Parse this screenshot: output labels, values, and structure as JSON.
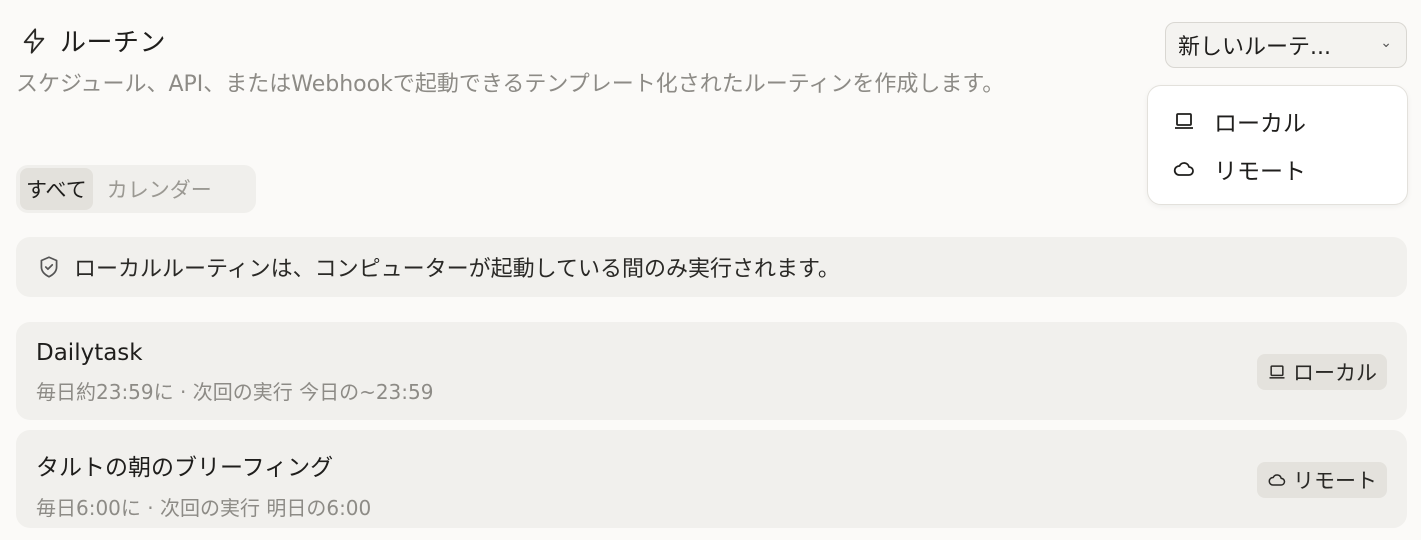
{
  "header": {
    "title": "ルーチン",
    "icon": "lightning-icon"
  },
  "description": "スケジュール、API、またはWebhookで起動できるテンプレート化されたルーティンを作成します。",
  "tabs": [
    {
      "label": "すべて",
      "active": true
    },
    {
      "label": "カレンダー",
      "active": false
    }
  ],
  "notice": {
    "icon": "shield-check-icon",
    "text": "ローカルルーティンは、コンピューターが起動している間のみ実行されます。"
  },
  "routines": [
    {
      "title": "Dailytask",
      "schedule": "毎日約23:59に · 次回の実行 今日の~23:59",
      "badge": {
        "icon": "laptop-icon",
        "label": "ローカル"
      }
    },
    {
      "title": "タルトの朝のブリーフィング",
      "schedule": "毎日6:00に · 次回の実行 明日の6:00",
      "badge": {
        "icon": "cloud-icon",
        "label": "リモート"
      }
    }
  ],
  "new_button": {
    "label": "新しいルーテ...",
    "chevron": "⌄"
  },
  "menu": {
    "items": [
      {
        "icon": "laptop-icon",
        "label": "ローカル"
      },
      {
        "icon": "cloud-icon",
        "label": "リモート"
      }
    ]
  }
}
